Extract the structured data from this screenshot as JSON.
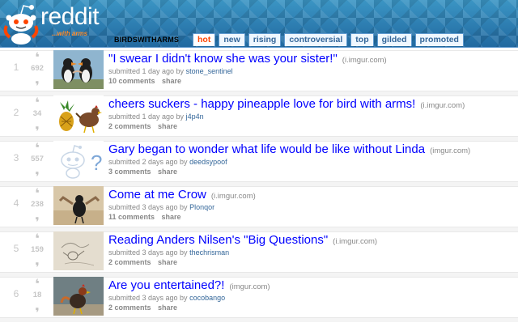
{
  "brand": {
    "logo_text": "reddit",
    "logo_sub": "...with arms"
  },
  "header": {
    "subreddit": "BIRDSWITHARMS",
    "tabs": [
      {
        "label": "hot",
        "selected": true
      },
      {
        "label": "new",
        "selected": false
      },
      {
        "label": "rising",
        "selected": false
      },
      {
        "label": "controversial",
        "selected": false
      },
      {
        "label": "top",
        "selected": false
      },
      {
        "label": "gilded",
        "selected": false
      },
      {
        "label": "promoted",
        "selected": false
      }
    ]
  },
  "colors": {
    "header_blue": "#2d7fae",
    "selected_tab": "#ff4500",
    "link_blue": "#0000ff",
    "author_blue": "#336699"
  },
  "posts": [
    {
      "rank": "1",
      "score": "692",
      "title": "\"I swear I didn't know she was your sister!\"",
      "domain": "(i.imgur.com)",
      "submitted": "submitted 1 day ago by",
      "author": "stone_sentinel",
      "comments": "10 comments",
      "share": "share",
      "thumb": "puffins"
    },
    {
      "rank": "2",
      "score": "34",
      "title": "cheers suckers - happy pineapple love for bird with arms!",
      "domain": "(i.imgur.com)",
      "submitted": "submitted 1 day ago by",
      "author": "j4p4n",
      "comments": "2 comments",
      "share": "share",
      "thumb": "pineapple"
    },
    {
      "rank": "3",
      "score": "557",
      "title": "Gary began to wonder what life would be like without Linda",
      "domain": "(imgur.com)",
      "submitted": "submitted 2 days ago by",
      "author": "deedsypoof",
      "comments": "3 comments",
      "share": "share",
      "thumb": "snoo-placeholder"
    },
    {
      "rank": "4",
      "score": "238",
      "title": "Come at me Crow",
      "domain": "(i.imgur.com)",
      "submitted": "submitted 3 days ago by",
      "author": "Plonqor",
      "comments": "11 comments",
      "share": "share",
      "thumb": "crow"
    },
    {
      "rank": "5",
      "score": "159",
      "title": "Reading Anders Nilsen's \"Big Questions\"",
      "domain": "(i.imgur.com)",
      "submitted": "submitted 3 days ago by",
      "author": "thechrisman",
      "comments": "2 comments",
      "share": "share",
      "thumb": "sketch"
    },
    {
      "rank": "6",
      "score": "18",
      "title": "Are you entertained?!",
      "domain": "(imgur.com)",
      "submitted": "submitted 3 days ago by",
      "author": "cocobango",
      "comments": "2 comments",
      "share": "share",
      "thumb": "rooster"
    }
  ]
}
